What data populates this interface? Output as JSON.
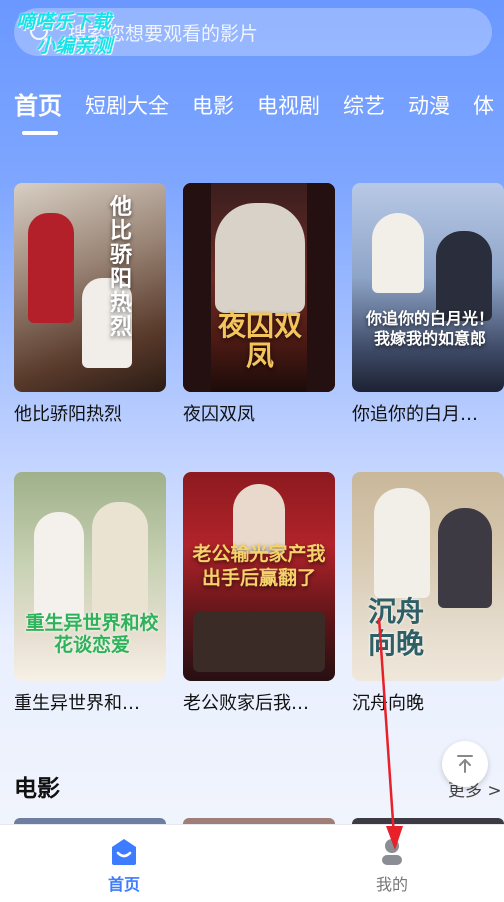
{
  "search": {
    "placeholder": "搜索您想要观看的影片"
  },
  "watermark": {
    "line1": "嘀嗒乐下载",
    "line2": "小编亲测"
  },
  "tabs": [
    {
      "label": "首页",
      "active": true
    },
    {
      "label": "短剧大全"
    },
    {
      "label": "电影"
    },
    {
      "label": "电视剧"
    },
    {
      "label": "综艺"
    },
    {
      "label": "动漫"
    },
    {
      "label": "体"
    }
  ],
  "cards": [
    {
      "title": "他比骄阳热烈",
      "poster_text": "他比骄阳热烈"
    },
    {
      "title": "夜囚双凤",
      "poster_text": "夜囚双凤"
    },
    {
      "title": "你追你的白月…",
      "poster_text": "你追你的白月光！我嫁我的如意郎"
    },
    {
      "title": "重生异世界和…",
      "poster_text": "重生异世界和校花谈恋爱"
    },
    {
      "title": "老公败家后我…",
      "poster_text": "老公输光家产我出手后赢翻了"
    },
    {
      "title": "沉舟向晚",
      "poster_text": "沉舟向晚"
    }
  ],
  "section": {
    "title": "电影",
    "more": "更多 >"
  },
  "bottom_nav": {
    "home": "首页",
    "me": "我的"
  },
  "colors": {
    "accent": "#3d7bff",
    "arrow": "#e8202a"
  }
}
